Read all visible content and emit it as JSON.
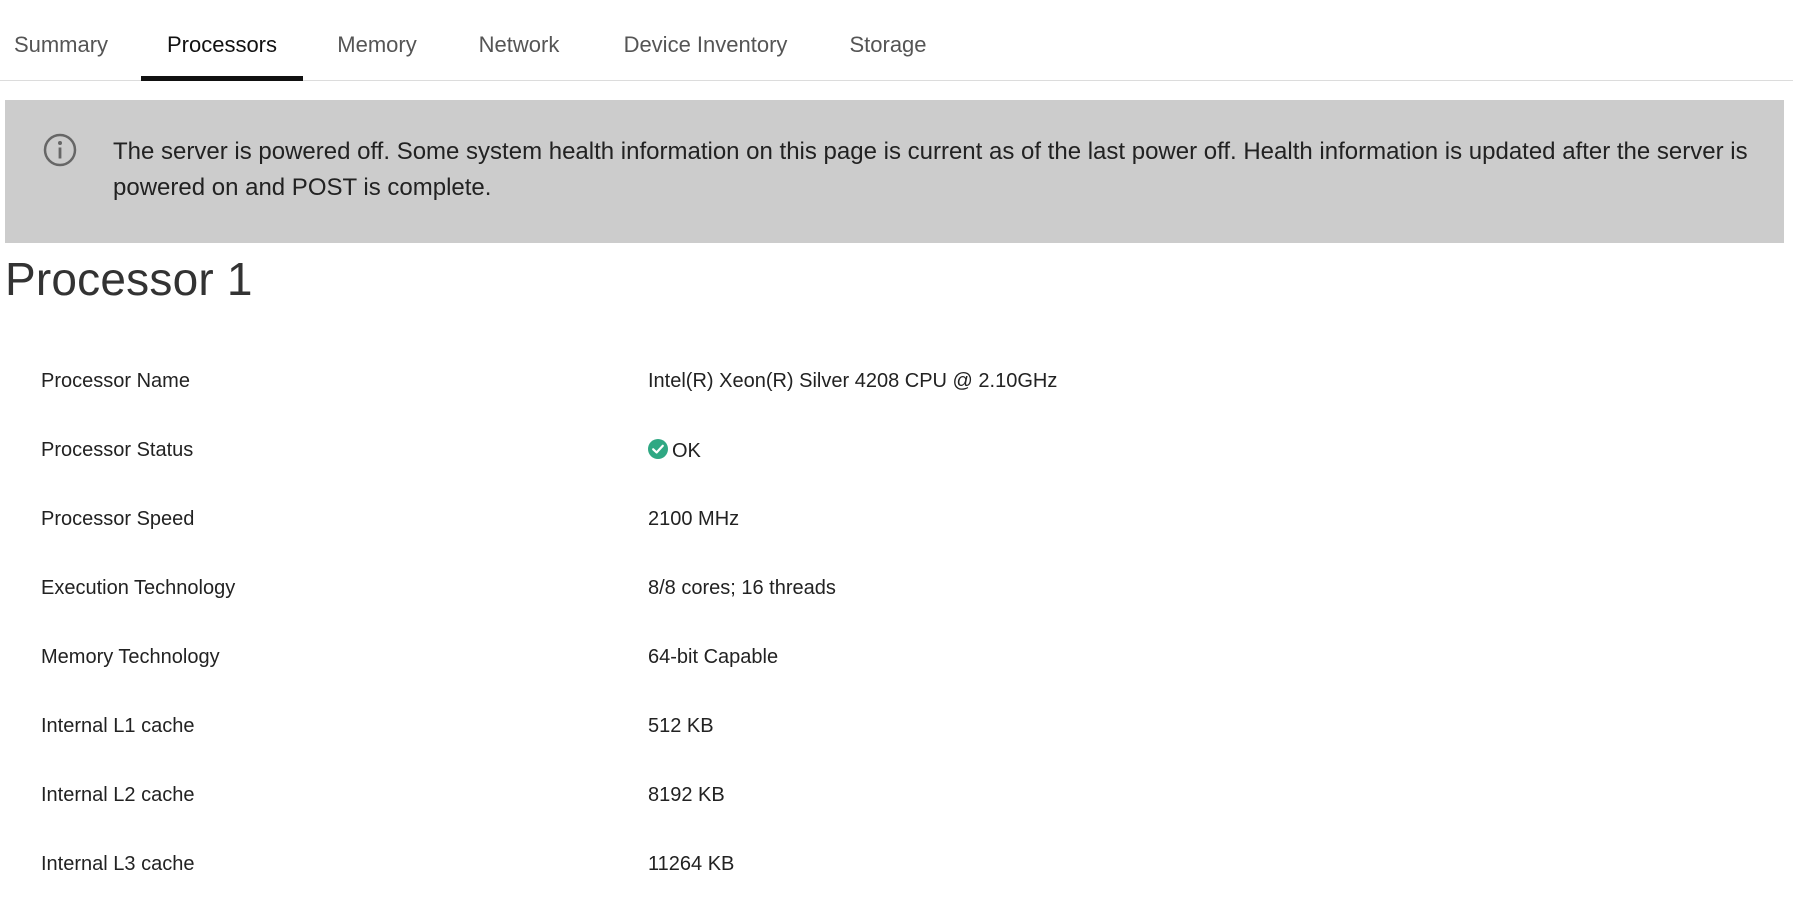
{
  "tabs": [
    {
      "label": "Summary",
      "active": false
    },
    {
      "label": "Processors",
      "active": true
    },
    {
      "label": "Memory",
      "active": false
    },
    {
      "label": "Network",
      "active": false
    },
    {
      "label": "Device Inventory",
      "active": false
    },
    {
      "label": "Storage",
      "active": false
    }
  ],
  "banner": {
    "icon": "info-icon",
    "text": "The server is powered off. Some system health information on this page is current as of the last power off. Health information is updated after the server is powered on and POST is complete."
  },
  "section": {
    "title": "Processor 1"
  },
  "details": [
    {
      "label": "Processor Name",
      "value": "Intel(R) Xeon(R) Silver 4208 CPU @ 2.10GHz"
    },
    {
      "label": "Processor Status",
      "value": "OK",
      "status_icon": "check-circle-icon"
    },
    {
      "label": "Processor Speed",
      "value": "2100 MHz"
    },
    {
      "label": "Execution Technology",
      "value": "8/8 cores; 16 threads"
    },
    {
      "label": "Memory Technology",
      "value": "64-bit Capable"
    },
    {
      "label": "Internal L1 cache",
      "value": "512 KB"
    },
    {
      "label": "Internal L2 cache",
      "value": "8192 KB"
    },
    {
      "label": "Internal L3 cache",
      "value": "11264 KB"
    }
  ],
  "colors": {
    "banner_bg": "#cccccc",
    "status_ok": "#2fa883",
    "active_tab_underline": "#111111"
  }
}
